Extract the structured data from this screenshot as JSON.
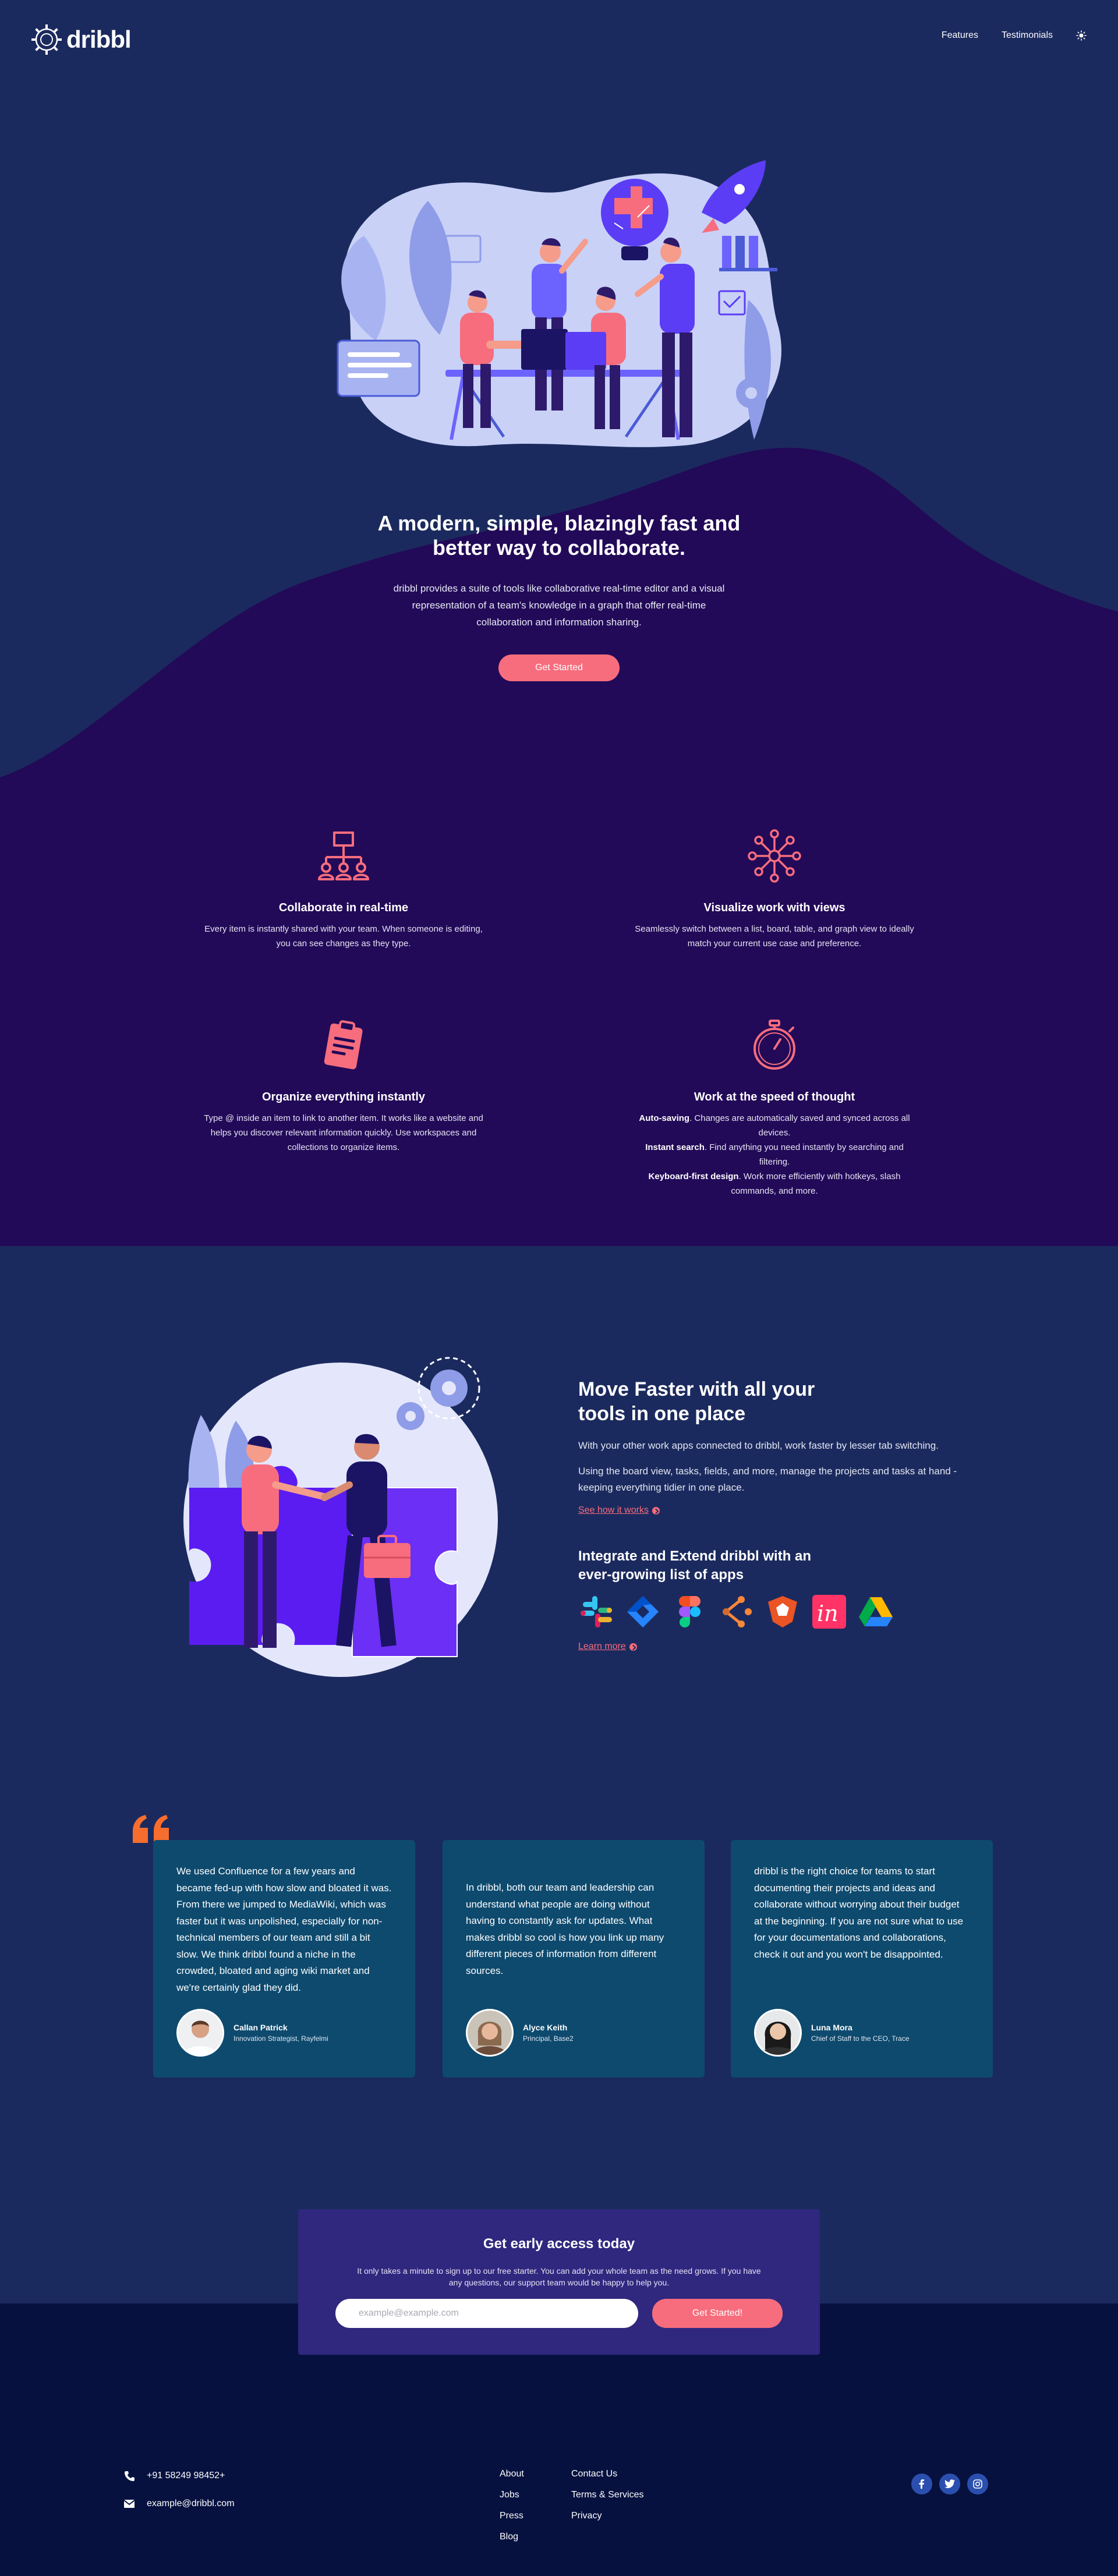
{
  "nav": {
    "logo_text": "dribbl",
    "links": [
      "Features",
      "Testimonials"
    ],
    "theme_toggle_icon": "sun-icon"
  },
  "hero": {
    "title": "A modern, simple, blazingly fast and better way to collaborate.",
    "text": "dribbl provides a suite of tools like collaborative real-time editor and a visual representation of a team's knowledge in a graph that offer real-time collaboration and information sharing.",
    "cta_label": "Get Started"
  },
  "features": [
    {
      "icon": "org-chart-icon",
      "title": "Collaborate in real-time",
      "text": "Every item is instantly shared with your team. When someone is editing, you can see changes as they type."
    },
    {
      "icon": "network-graph-icon",
      "title": "Visualize work with views",
      "text": "Seamlessly switch between a list, board, table, and graph view to ideally match your current use case and preference."
    },
    {
      "icon": "clipboard-icon",
      "title": "Organize everything instantly",
      "text": "Type @ inside an item to link to another item. It works like a website and helps you discover relevant information quickly. Use workspaces and collections to organize items."
    },
    {
      "icon": "stopwatch-icon",
      "title": "Work at the speed of thought",
      "lines": [
        {
          "bold": "Auto-saving",
          "rest": ". Changes are automatically saved and synced across all devices."
        },
        {
          "bold": "Instant search",
          "rest": ". Find anything you need instantly by searching and filtering."
        },
        {
          "bold": "Keyboard-first design",
          "rest": ". Work more efficiently with hotkeys, slash commands, and more."
        }
      ]
    }
  ],
  "integrations": {
    "title": "Move Faster with all your tools in one place",
    "para1": "With your other work apps connected to dribbl, work faster by lesser tab switching.",
    "para2": "Using the board view, tasks, fields, and more, manage the projects and tasks at hand - keeping everything tidier in one place.",
    "link1": "See how it works",
    "subtitle": "Integrate and Extend dribbl with an ever-growing list of apps",
    "apps": [
      "slack-icon",
      "jira-icon",
      "figma-icon",
      "clickup-icon",
      "auth0-icon",
      "invision-icon",
      "google-drive-icon"
    ],
    "link2": "Learn more"
  },
  "testimonials": [
    {
      "text": "We used Confluence for a few years and became fed-up with how slow and bloated it was. From there we jumped to MediaWiki, which was faster but it was unpolished, especially for non-technical members of our team and still a bit slow. We think dribbl found a niche in the crowded, bloated and aging wiki market and we're certainly glad they did.",
      "name": "Callan Patrick",
      "role": "Innovation Strategist, Rayfelmi"
    },
    {
      "text": "In dribbl, both our team and leadership can understand what people are doing without having to constantly ask for updates. What makes dribbl so cool is how you link up many different pieces of information from different sources.",
      "name": "Alyce Keith",
      "role": "Principal, Base2"
    },
    {
      "text": "dribbl is the right choice for teams to start documenting their projects and ideas and collaborate without worrying about their budget at the beginning. If you are not sure what to use for your documentations and collaborations, check it out and you won't be disappointed.",
      "name": "Luna Mora",
      "role": "Chief of Staff to the CEO, Trace"
    }
  ],
  "cta": {
    "title": "Get early access today",
    "text": "It only takes a minute to sign up to our free starter. You can add your whole team as the need grows. If you have any questions, our support team would be happy to help you.",
    "input_placeholder": "example@example.com",
    "button_label": "Get Started!"
  },
  "footer": {
    "phone": "+91 58249 98452+",
    "email": "example@dribbl.com",
    "col1": [
      "About",
      "Jobs",
      "Press",
      "Blog"
    ],
    "col2": [
      "Contact Us",
      "Terms & Services",
      "Privacy"
    ],
    "socials": [
      "facebook-icon",
      "twitter-icon",
      "instagram-icon"
    ]
  },
  "colors": {
    "navy": "#1b2a5e",
    "deep_purple": "#220a58",
    "accent_pink": "#f76d7d",
    "card_teal": "#0e4a6e",
    "footer": "#06113f"
  }
}
